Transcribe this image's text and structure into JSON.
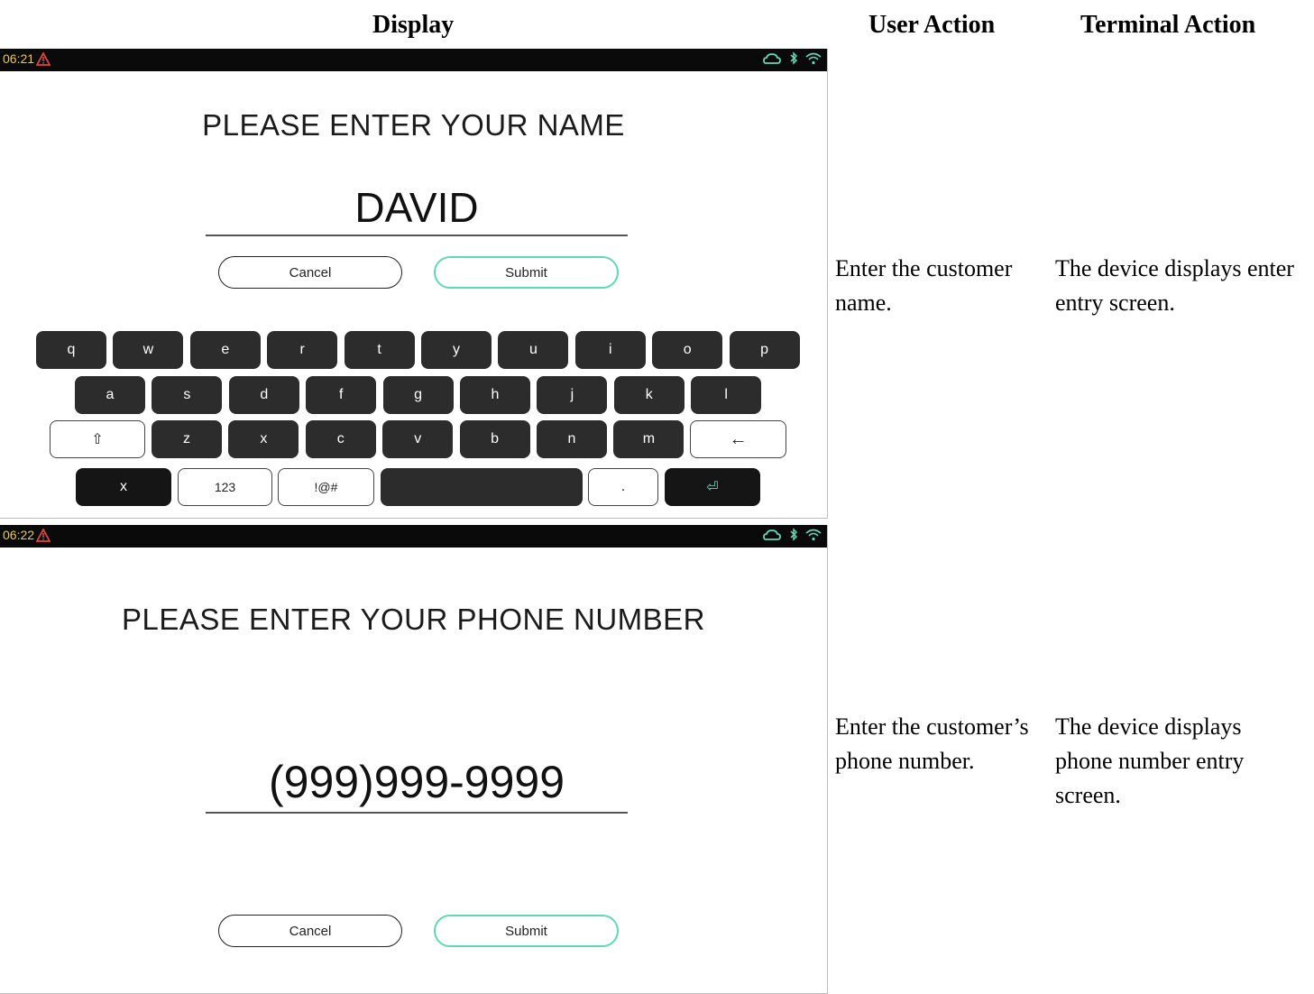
{
  "headers": {
    "display": "Display",
    "user_action": "User Action",
    "terminal_action": "Terminal Action"
  },
  "rows": [
    {
      "status_time": "06:21",
      "prompt": "PLEASE ENTER YOUR NAME",
      "entry_value": "DAVID",
      "cancel": "Cancel",
      "submit": "Submit",
      "user_action": "Enter the customer name.",
      "terminal_action": "The device displays enter entry screen."
    },
    {
      "status_time": "06:22",
      "prompt": "PLEASE ENTER YOUR PHONE NUMBER",
      "entry_value": "(999)999-9999",
      "cancel": "Cancel",
      "submit": "Submit",
      "user_action": "Enter the customer’s phone number.",
      "terminal_action": "The device displays phone number entry screen."
    }
  ],
  "keyboard": {
    "row1": [
      "q",
      "w",
      "e",
      "r",
      "t",
      "y",
      "u",
      "i",
      "o",
      "p"
    ],
    "row2": [
      "a",
      "s",
      "d",
      "f",
      "g",
      "h",
      "j",
      "k",
      "l"
    ],
    "row3": [
      "z",
      "x",
      "c",
      "v",
      "b",
      "n",
      "m"
    ],
    "shift": "⇧",
    "backspace": "←",
    "close": "x",
    "numbers": "123",
    "symbols": "!@#",
    "space": "",
    "period": ".",
    "enter": "⏎"
  },
  "colors": {
    "accent": "#5fd8b7",
    "status_time": "#e9c949",
    "warning": "#e0453a"
  },
  "icons": [
    "warning-icon",
    "cloud-icon",
    "bluetooth-icon",
    "wifi-icon"
  ]
}
